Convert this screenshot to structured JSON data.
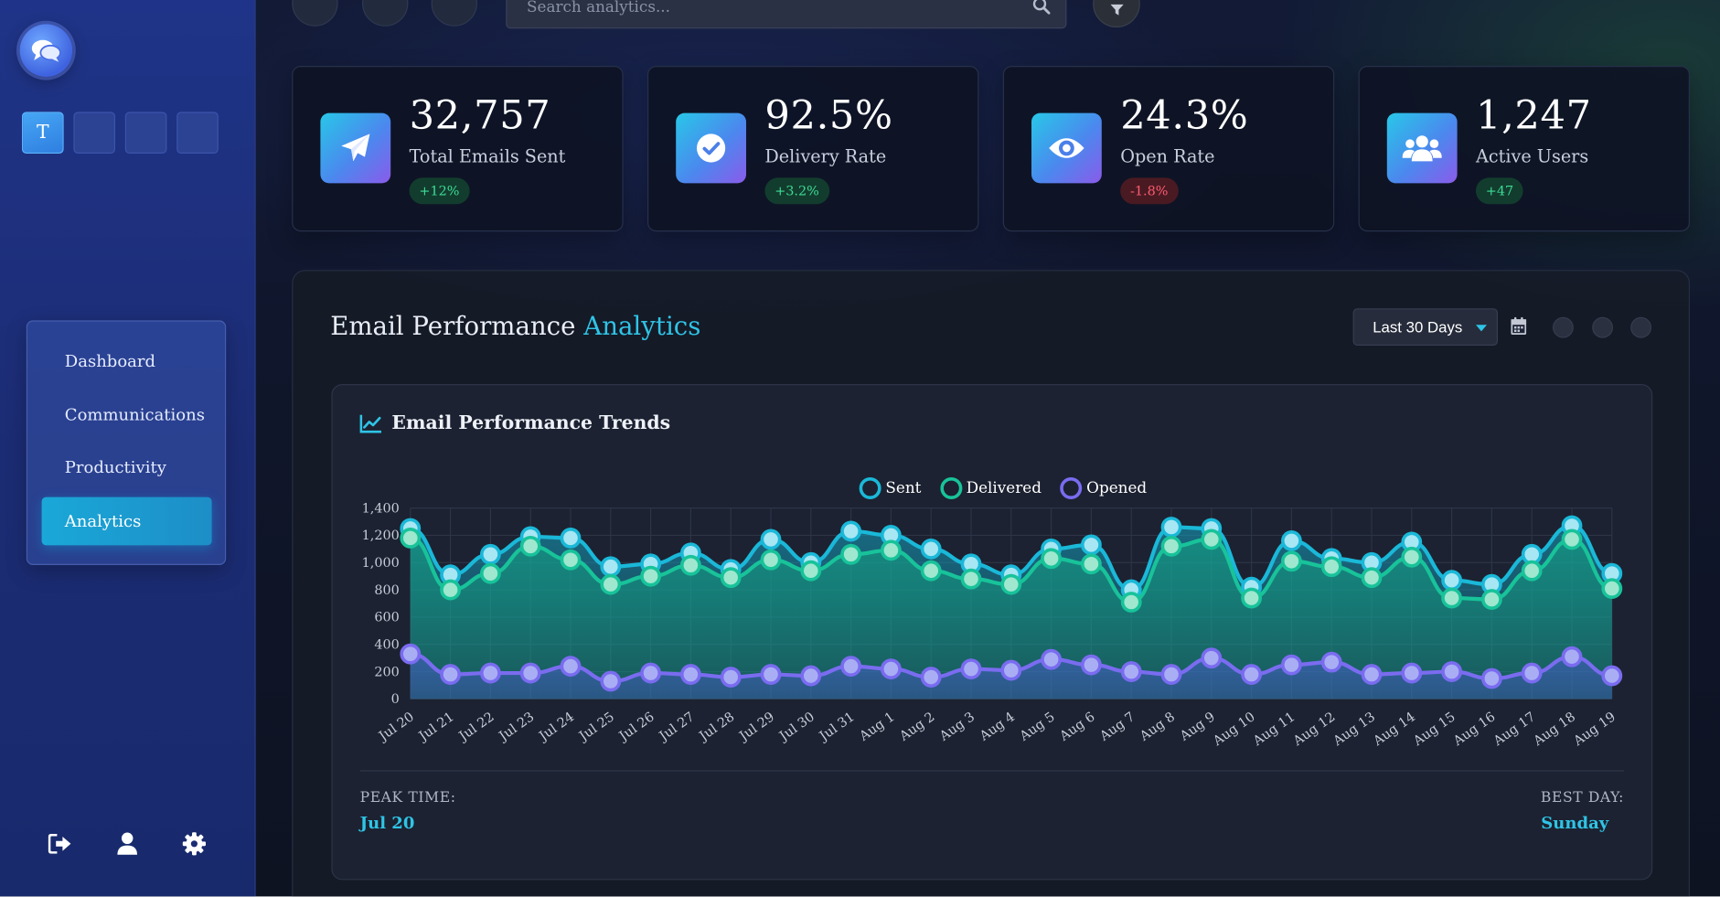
{
  "search": {
    "placeholder": "Search analytics..."
  },
  "sidebar": {
    "workspace_initial": "T",
    "nav": [
      {
        "label": "Dashboard"
      },
      {
        "label": "Communications"
      },
      {
        "label": "Productivity"
      },
      {
        "label": "Analytics",
        "active": true
      }
    ],
    "footer_icons": [
      "sign-out-icon",
      "user-icon",
      "settings-icon"
    ]
  },
  "stats": [
    {
      "value": "32,757",
      "label": "Total Emails Sent",
      "change": "+12%",
      "trend": "up",
      "icon": "paper-plane-icon"
    },
    {
      "value": "92.5%",
      "label": "Delivery Rate",
      "change": "+3.2%",
      "trend": "up",
      "icon": "check-circle-icon"
    },
    {
      "value": "24.3%",
      "label": "Open Rate",
      "change": "-1.8%",
      "trend": "down",
      "icon": "eye-icon"
    },
    {
      "value": "1,247",
      "label": "Active Users",
      "change": "+47",
      "trend": "up",
      "icon": "users-icon"
    }
  ],
  "section": {
    "title_plain": "Email Performance ",
    "title_accent": "Analytics",
    "range_label": "Last 30 Days",
    "chart_title": "Email Performance Trends",
    "peak_label": "PEAK TIME:",
    "peak_value": "Jul 20",
    "best_label": "BEST DAY:",
    "best_value": "Sunday"
  },
  "colors": {
    "accent": "#2fc4e6",
    "sent": "#1ab8d8",
    "delivered": "#18c39a",
    "opened": "#7a6cf0",
    "positive": "#3ddc97",
    "negative": "#ff5b6e"
  },
  "chart_data": {
    "type": "line",
    "categories": [
      "Jul 20",
      "Jul 21",
      "Jul 22",
      "Jul 23",
      "Jul 24",
      "Jul 25",
      "Jul 26",
      "Jul 27",
      "Jul 28",
      "Jul 29",
      "Jul 30",
      "Jul 31",
      "Aug 1",
      "Aug 2",
      "Aug 3",
      "Aug 4",
      "Aug 5",
      "Aug 6",
      "Aug 7",
      "Aug 8",
      "Aug 9",
      "Aug 10",
      "Aug 11",
      "Aug 12",
      "Aug 13",
      "Aug 14",
      "Aug 15",
      "Aug 16",
      "Aug 17",
      "Aug 18",
      "Aug 19"
    ],
    "series": [
      {
        "name": "Sent",
        "color": "#1ab8d8",
        "values": [
          1250,
          910,
          1060,
          1190,
          1180,
          970,
          990,
          1070,
          950,
          1170,
          1000,
          1230,
          1200,
          1100,
          990,
          910,
          1100,
          1130,
          800,
          1260,
          1250,
          820,
          1160,
          1030,
          1000,
          1150,
          870,
          840,
          1060,
          1270,
          920
        ]
      },
      {
        "name": "Delivered",
        "color": "#18c39a",
        "values": [
          1180,
          800,
          920,
          1120,
          1020,
          840,
          900,
          980,
          890,
          1020,
          940,
          1060,
          1090,
          940,
          880,
          840,
          1030,
          990,
          710,
          1120,
          1170,
          740,
          1010,
          970,
          890,
          1040,
          740,
          730,
          940,
          1170,
          810
        ]
      },
      {
        "name": "Opened",
        "color": "#7a6cf0",
        "values": [
          330,
          180,
          190,
          190,
          240,
          130,
          190,
          180,
          160,
          180,
          170,
          240,
          220,
          160,
          220,
          210,
          290,
          250,
          200,
          180,
          300,
          180,
          250,
          270,
          180,
          190,
          200,
          150,
          190,
          310,
          170
        ]
      }
    ],
    "ylim": [
      0,
      1400
    ],
    "yticks": [
      0,
      200,
      400,
      600,
      800,
      1000,
      1200,
      1400
    ],
    "ytick_labels": [
      "0",
      "200",
      "400",
      "600",
      "800",
      "1,000",
      "1,200",
      "1,400"
    ],
    "legend_position": "top-center",
    "grid": true
  }
}
